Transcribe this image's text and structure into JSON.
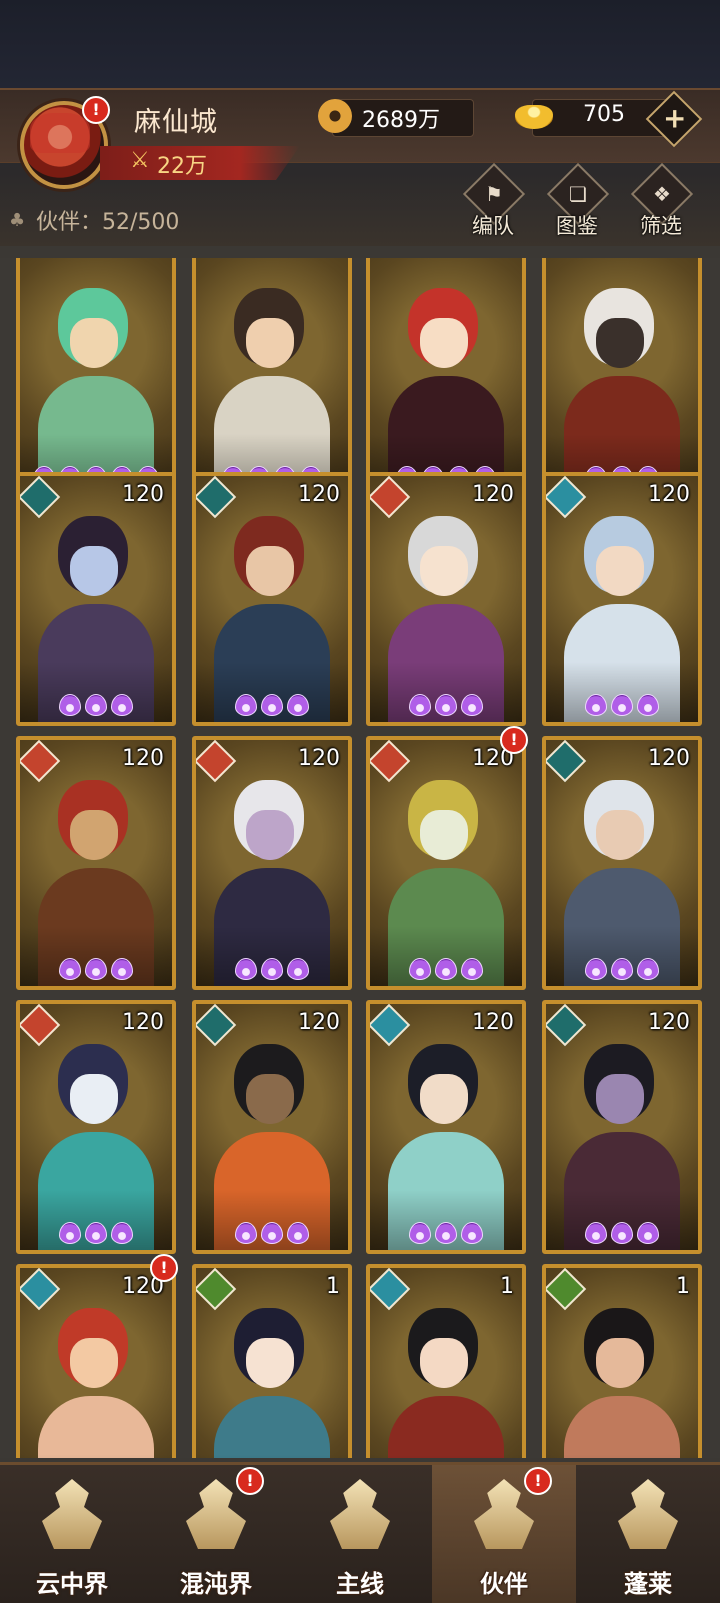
{
  "header": {
    "player_name": "麻仙城",
    "power": "22万",
    "coins": "2689万",
    "gold": "705",
    "plus_label": "+",
    "partners_label": "伙伴：52/500",
    "tools": [
      {
        "label": "编队",
        "icon": "formation-flag-icon"
      },
      {
        "label": "图鉴",
        "icon": "codex-scroll-icon"
      },
      {
        "label": "筛选",
        "icon": "filter-diamond-icon"
      }
    ]
  },
  "cards": [
    {
      "level": "",
      "element": "",
      "stars": 5,
      "hair": "#5dc89b",
      "skin": "#f0d5ae",
      "cloth": "#76b98e"
    },
    {
      "level": "",
      "element": "",
      "stars": 4,
      "hair": "#3a2b22",
      "skin": "#efcfae",
      "cloth": "#d9d3c4"
    },
    {
      "level": "",
      "element": "",
      "stars": 4,
      "hair": "#c4332a",
      "skin": "#f7ddc4",
      "cloth": "#3a1a1f"
    },
    {
      "level": "",
      "element": "",
      "stars": 3,
      "hair": "#e8e4df",
      "skin": "#3a302b",
      "cloth": "#7c2a1c"
    },
    {
      "level": "120",
      "element": "teal",
      "stars": 3,
      "hair": "#2b2033",
      "skin": "#b7c7e7",
      "cloth": "#4a3b5c"
    },
    {
      "level": "120",
      "element": "teal",
      "stars": 3,
      "hair": "#7e2a1f",
      "skin": "#e8c6a6",
      "cloth": "#2b3e56"
    },
    {
      "level": "120",
      "element": "red",
      "stars": 3,
      "hair": "#d8d8d8",
      "skin": "#f6e2cf",
      "cloth": "#7a3d79"
    },
    {
      "level": "120",
      "element": "cyan",
      "stars": 3,
      "hair": "#b7cbe0",
      "skin": "#f2d9c3",
      "cloth": "#d6e1ea"
    },
    {
      "level": "120",
      "element": "red",
      "stars": 3,
      "hair": "#a93123",
      "skin": "#d1a470",
      "cloth": "#6b3a1f"
    },
    {
      "level": "120",
      "element": "red",
      "stars": 3,
      "hair": "#e7e6ea",
      "skin": "#bda5c9",
      "cloth": "#2e2a42"
    },
    {
      "level": "120",
      "element": "red",
      "stars": 3,
      "hair": "#c9b545",
      "skin": "#e8ecd6",
      "cloth": "#5c8a4f"
    },
    {
      "level": "120",
      "element": "teal",
      "stars": 3,
      "hair": "#dfe4ea",
      "skin": "#e8cbb3",
      "cloth": "#4e5a6e"
    },
    {
      "level": "120",
      "element": "red",
      "stars": 3,
      "hair": "#2c2e4f",
      "skin": "#e9eef4",
      "cloth": "#3aa6a0"
    },
    {
      "level": "120",
      "element": "teal",
      "stars": 3,
      "hair": "#1c1b1d",
      "skin": "#8a6a4b",
      "cloth": "#d9652a"
    },
    {
      "level": "120",
      "element": "cyan",
      "stars": 3,
      "hair": "#1c1e28",
      "skin": "#f1dcc8",
      "cloth": "#8fd0c8"
    },
    {
      "level": "120",
      "element": "teal",
      "stars": 3,
      "hair": "#1c1b22",
      "skin": "#9a86b0",
      "cloth": "#4a2a36"
    },
    {
      "level": "120",
      "element": "cyan",
      "stars": 0,
      "hair": "#c03a28",
      "skin": "#f3c9a3",
      "cloth": "#e8b898"
    },
    {
      "level": "1",
      "element": "green",
      "stars": 0,
      "hair": "#1e1e33",
      "skin": "#f6e2d2",
      "cloth": "#3e7b8a"
    },
    {
      "level": "1",
      "element": "cyan",
      "stars": 0,
      "hair": "#1b1a1c",
      "skin": "#f4d9c4",
      "cloth": "#8a2a20"
    },
    {
      "level": "1",
      "element": "green",
      "stars": 0,
      "hair": "#1a1718",
      "skin": "#e5b99a",
      "cloth": "#c07a5c"
    }
  ],
  "card_badges": [
    10,
    16
  ],
  "nav": [
    {
      "label": "云中界",
      "badge": false,
      "active": false
    },
    {
      "label": "混沌界",
      "badge": true,
      "active": false
    },
    {
      "label": "主线",
      "badge": false,
      "active": false
    },
    {
      "label": "伙伴",
      "badge": true,
      "active": true
    },
    {
      "label": "蓬莱",
      "badge": false,
      "active": false
    }
  ],
  "badge_label": "!",
  "colors": {
    "frame": "#c58f2d",
    "teal": "#1f6d6b",
    "red": "#c4442d",
    "cyan": "#2b8fa0",
    "green": "#4f8a2d",
    "badge": "#d82a1e"
  }
}
